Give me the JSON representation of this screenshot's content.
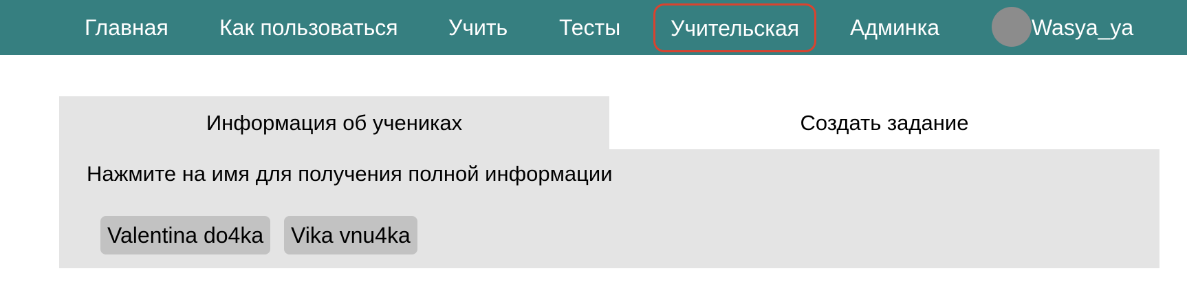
{
  "colors": {
    "navbar_bg": "#367f80",
    "active_outline": "#d9432f",
    "panel_bg": "#e4e4e4",
    "chip_bg": "#c2c2c2",
    "avatar_bg": "#8c8c8c"
  },
  "nav": {
    "items": [
      {
        "label": "Главная"
      },
      {
        "label": "Как пользоваться"
      },
      {
        "label": "Учить"
      },
      {
        "label": "Тесты"
      },
      {
        "label": "Учительская",
        "active": true
      },
      {
        "label": "Админка"
      }
    ],
    "user": {
      "name": "Wasya_ya",
      "avatar": "user-avatar-icon"
    }
  },
  "tabs": [
    {
      "label": "Информация об учениках",
      "selected": true
    },
    {
      "label": "Создать задание",
      "selected": false
    }
  ],
  "students_panel": {
    "hint": "Нажмите на имя для получения полной информации",
    "students": [
      "Valentina do4ka",
      "Vika vnu4ka"
    ]
  }
}
